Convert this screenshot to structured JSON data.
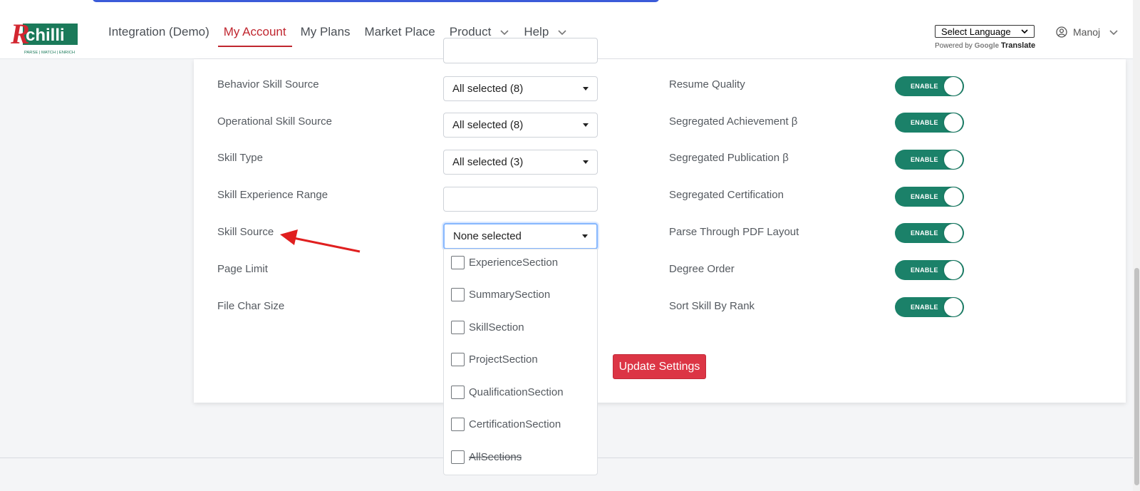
{
  "brand": {
    "logo_text": "chilli",
    "tagline": "PARSE | MATCH | ENRICH"
  },
  "nav": {
    "items": [
      {
        "label": "Integration (Demo)"
      },
      {
        "label": "My Account",
        "active": true
      },
      {
        "label": "My Plans"
      },
      {
        "label": "Market Place"
      },
      {
        "label": "Product",
        "has_dropdown": true
      },
      {
        "label": "Help",
        "has_dropdown": true
      }
    ]
  },
  "language": {
    "select_label": "Select Language",
    "powered_by": "Powered by",
    "google": "Google",
    "translate": "Translate"
  },
  "user": {
    "name": "Manoj"
  },
  "left_settings": [
    {
      "label": "Behavior Skill Source",
      "value": "All selected (8)"
    },
    {
      "label": "Operational Skill Source",
      "value": "All selected (8)"
    },
    {
      "label": "Skill Type",
      "value": "All selected (3)"
    },
    {
      "label": "Skill Experience Range",
      "value": ""
    },
    {
      "label": "Skill Source",
      "value": "None selected"
    },
    {
      "label": "Page Limit",
      "value": ""
    },
    {
      "label": "File Char Size",
      "value": ""
    }
  ],
  "right_settings": [
    {
      "label": "Resume Quality",
      "toggle": "ENABLE"
    },
    {
      "label": "Segregated Achievement β",
      "toggle": "ENABLE"
    },
    {
      "label": "Segregated Publication β",
      "toggle": "ENABLE"
    },
    {
      "label": "Segregated Certification",
      "toggle": "ENABLE"
    },
    {
      "label": "Parse Through PDF Layout",
      "toggle": "ENABLE"
    },
    {
      "label": "Degree Order",
      "toggle": "ENABLE"
    },
    {
      "label": "Sort Skill By Rank",
      "toggle": "ENABLE"
    }
  ],
  "skill_source_options": [
    {
      "label": "ExperienceSection",
      "checked": false
    },
    {
      "label": "SummarySection",
      "checked": false
    },
    {
      "label": "SkillSection",
      "checked": false
    },
    {
      "label": "ProjectSection",
      "checked": false
    },
    {
      "label": "QualificationSection",
      "checked": false
    },
    {
      "label": "CertificationSection",
      "checked": false
    },
    {
      "label": "AllSections",
      "checked": false
    }
  ],
  "update_button": "Update Settings",
  "colors": {
    "accent_red": "#c0262f",
    "toggle_green": "#1b8169",
    "button_red": "#dc3545",
    "arrow_red": "#e01f1f"
  }
}
